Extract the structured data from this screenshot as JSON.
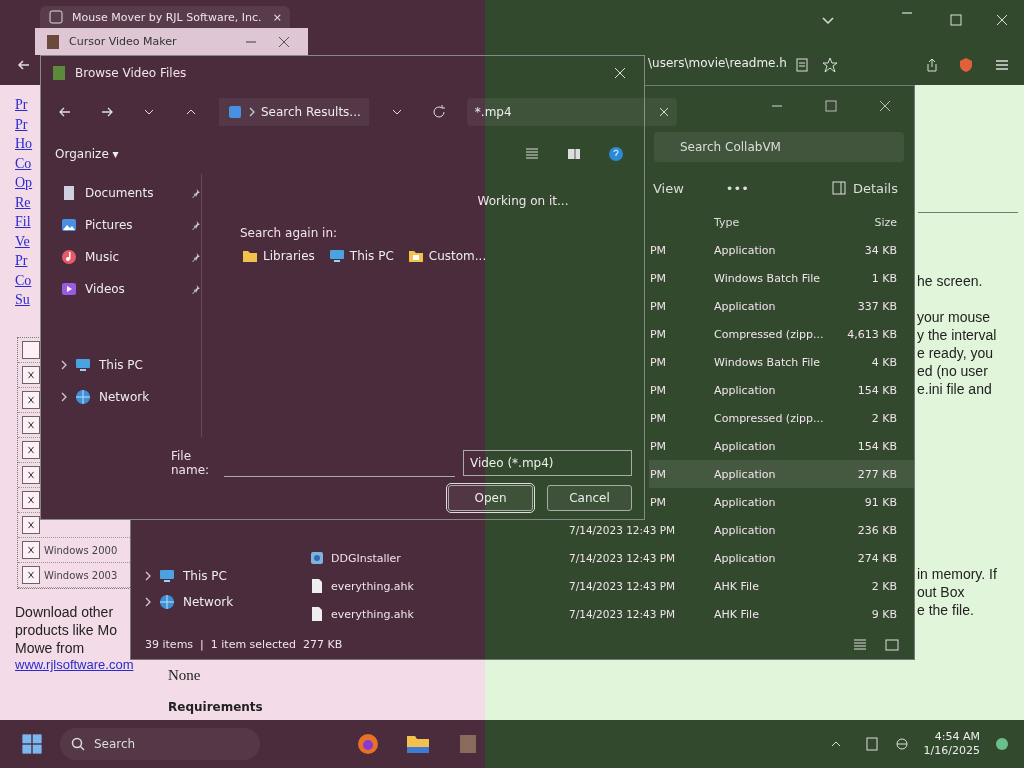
{
  "browser": {
    "tab_title": "Mouse Mover by RJL Software, Inc.",
    "tab_close": "×",
    "address": "\\users\\movie\\readme.h"
  },
  "page": {
    "links": [
      "Pr",
      "Pr",
      "Ho",
      "Co",
      "Op",
      "Re",
      "Fil",
      "Ve",
      "Pr",
      "Co",
      "Su"
    ],
    "checkbox_rows": [
      {
        "checked": false
      },
      {
        "checked": true
      },
      {
        "checked": true
      },
      {
        "checked": true
      },
      {
        "checked": true
      },
      {
        "checked": true
      },
      {
        "checked": true
      },
      {
        "checked": true
      },
      {
        "checked": true,
        "label": "Windows 2000"
      },
      {
        "checked": true,
        "label": "Windows 2003"
      }
    ],
    "promo_lines": [
      "Download other",
      "products like Mo",
      "Mowe from"
    ],
    "promo_link": "www.rjlsoftware.com",
    "none_text": "None",
    "requirements_heading": "Requirements",
    "right_paragraphs": [
      [
        "he screen."
      ],
      [
        "your mouse",
        "y the interval",
        "e ready, you",
        "ed (no user",
        "e.ini file and"
      ],
      [
        "in memory. If",
        "out Box",
        "e the file."
      ]
    ]
  },
  "explorer": {
    "search": {
      "placeholder": "Search CollabVM"
    },
    "toolbar": [
      "View",
      "•••",
      "Details"
    ],
    "columns": [
      "Type",
      "Size"
    ],
    "nav": [
      "This PC",
      "Network"
    ],
    "rows": [
      {
        "date": "PM",
        "type": "Application",
        "size": "34 KB",
        "selected": false
      },
      {
        "date": "PM",
        "type": "Windows Batch File",
        "size": "1 KB",
        "selected": false
      },
      {
        "date": "PM",
        "type": "Application",
        "size": "337 KB",
        "selected": false
      },
      {
        "date": "PM",
        "type": "Compressed (zipp...",
        "size": "4,613 KB",
        "selected": false
      },
      {
        "date": "PM",
        "type": "Windows Batch File",
        "size": "4 KB",
        "selected": false
      },
      {
        "date": "PM",
        "type": "Application",
        "size": "154 KB",
        "selected": false
      },
      {
        "date": "PM",
        "type": "Compressed (zipp...",
        "size": "2 KB",
        "selected": false
      },
      {
        "date": "PM",
        "type": "Application",
        "size": "154 KB",
        "selected": false
      },
      {
        "date": "PM",
        "type": "Application",
        "size": "277 KB",
        "selected": true
      },
      {
        "date": "PM",
        "type": "Application",
        "size": "91 KB",
        "selected": false
      },
      {
        "date": "7/14/2023 12:43 PM",
        "type": "Application",
        "size": "236 KB",
        "selected": false
      },
      {
        "name": "DDGInstaller",
        "kind": "app",
        "date": "7/14/2023 12:43 PM",
        "type": "Application",
        "size": "274 KB",
        "selected": false
      },
      {
        "name": "everything.ahk",
        "kind": "file",
        "date": "7/14/2023 12:43 PM",
        "type": "AHK File",
        "size": "2 KB",
        "selected": false
      },
      {
        "name": "everything.ahk",
        "kind": "file",
        "date": "7/14/2023 12:43 PM",
        "type": "AHK File",
        "size": "9 KB",
        "selected": false
      }
    ],
    "status": "39 items  |  1 item selected  277 KB"
  },
  "app_window": {
    "title": "Cursor Video Maker"
  },
  "dialog": {
    "title": "Browse Video Files",
    "breadcrumb": "Search Results...",
    "search_value": "*.mp4",
    "organize": "Organize ▾",
    "nav": [
      {
        "label": "Documents",
        "kind": "pinned"
      },
      {
        "label": "Pictures",
        "kind": "pinned"
      },
      {
        "label": "Music",
        "kind": "pinned"
      },
      {
        "label": "Videos",
        "kind": "pinned"
      },
      {
        "label": "This PC",
        "kind": "tree"
      },
      {
        "label": "Network",
        "kind": "tree"
      }
    ],
    "status": "Working on it...",
    "search_again": "Search again in:",
    "locations": [
      "Libraries",
      "This PC",
      "Custom..."
    ],
    "file_name_label": "File name:",
    "filter": "Video (*.mp4)",
    "buttons": [
      "Open",
      "Cancel"
    ]
  },
  "taskbar": {
    "search": "Search",
    "time": "4:54 AM",
    "date": "1/16/2025"
  }
}
